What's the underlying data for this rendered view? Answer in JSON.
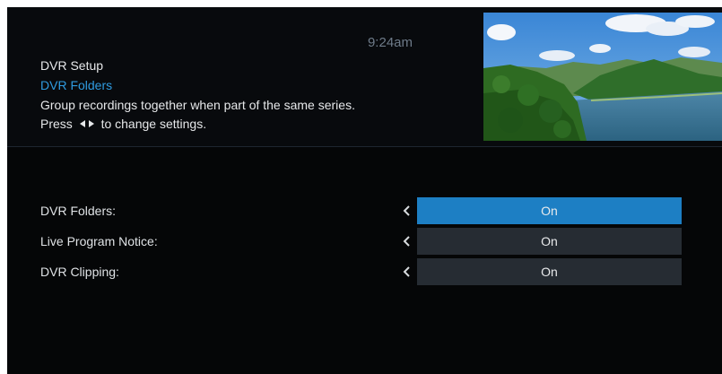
{
  "header": {
    "clock": "9:24am",
    "breadcrumb": "DVR Setup",
    "section_title": "DVR Folders",
    "description_line1": "Group recordings together when part of the same series.",
    "description_prefix": "Press",
    "description_suffix": "to change settings."
  },
  "settings": [
    {
      "label": "DVR Folders:",
      "value": "On",
      "selected": true
    },
    {
      "label": "Live Program Notice:",
      "value": "On",
      "selected": false
    },
    {
      "label": "DVR Clipping:",
      "value": "On",
      "selected": false
    }
  ],
  "colors": {
    "background": "#050607",
    "accent": "#1d7fc4",
    "section_title": "#2f9be0",
    "value_box": "#262c33"
  },
  "icons": {
    "left_right_arrows": "left-right-arrows-icon",
    "chevron_left": "chevron-left-icon"
  }
}
